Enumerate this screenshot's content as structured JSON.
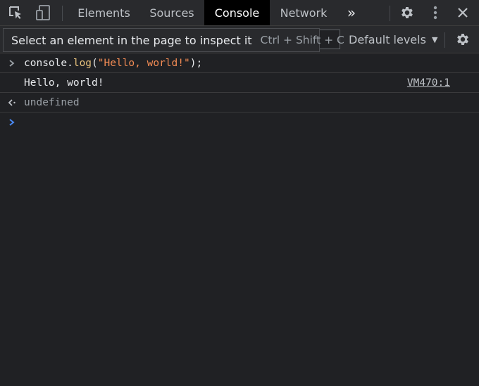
{
  "tabbar": {
    "tabs": [
      {
        "label": "Elements",
        "active": false
      },
      {
        "label": "Sources",
        "active": false
      },
      {
        "label": "Console",
        "active": true
      },
      {
        "label": "Network",
        "active": false
      }
    ],
    "more_tabs_label": "»",
    "icons": {
      "inspect": "inspect-element-icon",
      "device": "device-toolbar-icon",
      "settings": "gear-icon",
      "menu": "more-vertical-icon",
      "close": "close-icon"
    }
  },
  "toolbar": {
    "filter_value": "",
    "levels_label": "Default levels",
    "levels_caret": "▼"
  },
  "tooltip": {
    "text": "Select an element in the page to inspect it",
    "shortcut": "Ctrl + Shift + C"
  },
  "console": {
    "input": {
      "tokens": [
        {
          "text": "console.",
          "type": "plain"
        },
        {
          "text": "log",
          "type": "func"
        },
        {
          "text": "(",
          "type": "plain"
        },
        {
          "text": "\"Hello, world!\"",
          "type": "str"
        },
        {
          "text": ");",
          "type": "plain"
        }
      ]
    },
    "log": {
      "text": "Hello, world!",
      "source": "VM470:1"
    },
    "result": {
      "text": "undefined"
    }
  },
  "colors": {
    "background": "#202124",
    "toolbar": "#292a2d",
    "active_tab": "#000000",
    "string": "#f28b54",
    "function": "#e5c07b",
    "prompt_accent": "#4a8af4"
  }
}
